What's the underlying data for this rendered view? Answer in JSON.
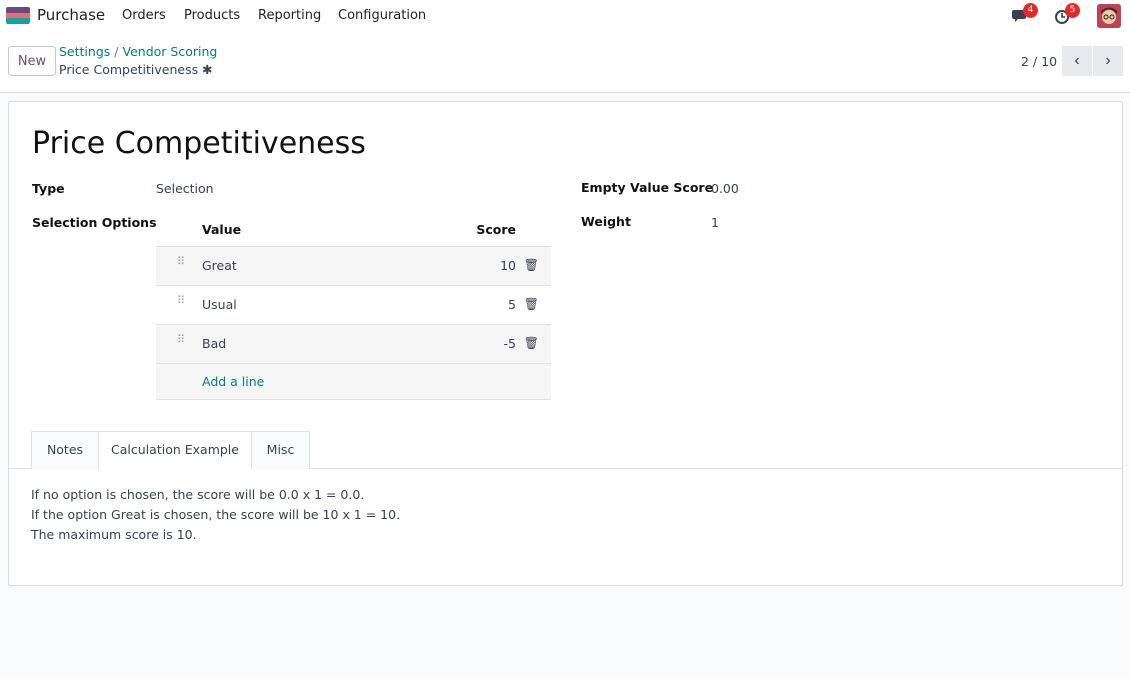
{
  "navbar": {
    "app_name": "Purchase",
    "menu": [
      "Orders",
      "Products",
      "Reporting",
      "Configuration"
    ],
    "messages_count": "4",
    "activities_count": "5"
  },
  "control": {
    "new_label": "New",
    "breadcrumb": [
      "Settings",
      "Vendor Scoring"
    ],
    "record_name": "Price Competitiveness",
    "pager": "2 / 10"
  },
  "form": {
    "title": "Price Competitiveness",
    "type_label": "Type",
    "type_value": "Selection",
    "options_label": "Selection Options",
    "empty_value_label": "Empty Value Score",
    "empty_value": "0.00",
    "weight_label": "Weight",
    "weight_value": "1",
    "table": {
      "col_value": "Value",
      "col_score": "Score",
      "rows": [
        {
          "value": "Great",
          "score": "10"
        },
        {
          "value": "Usual",
          "score": "5"
        },
        {
          "value": "Bad",
          "score": "-5"
        }
      ],
      "add_line": "Add a line"
    }
  },
  "tabs": {
    "items": [
      "Notes",
      "Calculation Example",
      "Misc"
    ],
    "active": "Calculation Example",
    "content": [
      "If no option is chosen, the score will be 0.0 x 1 = 0.0.",
      "If the option Great is chosen, the score will be 10 x 1 = 10.",
      "The maximum score is 10."
    ]
  },
  "colors": {
    "brand": "#714b67",
    "link": "#017e84",
    "badge": "#e02b2b"
  }
}
